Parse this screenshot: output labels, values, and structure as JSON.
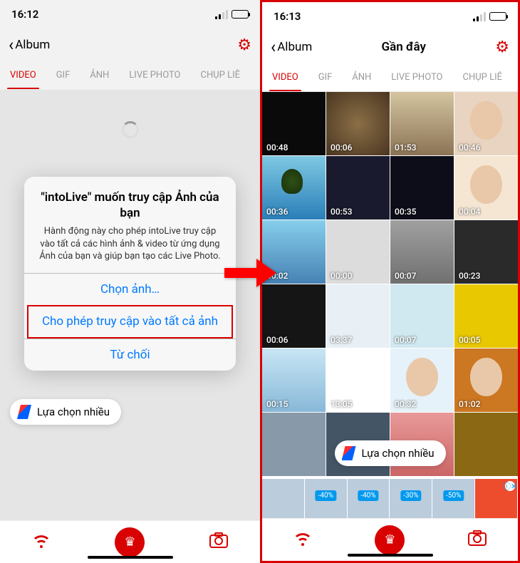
{
  "left": {
    "status_time": "16:12",
    "back_label": "Album",
    "tabs": [
      "VIDEO",
      "GIF",
      "ẢNH",
      "LIVE PHOTO",
      "CHỤP LIÊ"
    ],
    "alert": {
      "title": "\"intoLive\" muốn truy cập Ảnh của bạn",
      "message": "Hành động này cho phép intoLive truy cập vào tất cả các hình ảnh & video từ ứng dụng Ảnh của bạn và giúp bạn tạo các Live Photo.",
      "btn_select": "Chọn ảnh…",
      "btn_allow": "Cho phép truy cập vào tất cả ảnh",
      "btn_deny": "Từ chối"
    },
    "pill_label": "Lựa chọn nhiều"
  },
  "right": {
    "status_time": "16:13",
    "back_label": "Album",
    "title": "Gần đây",
    "tabs": [
      "VIDEO",
      "GIF",
      "ẢNH",
      "LIVE PHOTO",
      "CHỤP LIÊ"
    ],
    "pill_label": "Lựa chọn nhiều",
    "videos": [
      {
        "dur": "00:48"
      },
      {
        "dur": "00:06"
      },
      {
        "dur": "01:53"
      },
      {
        "dur": "00:46"
      },
      {
        "dur": "00:36"
      },
      {
        "dur": "00:53"
      },
      {
        "dur": "00:35"
      },
      {
        "dur": "00:04"
      },
      {
        "dur": "00:02"
      },
      {
        "dur": "00:00"
      },
      {
        "dur": "00:07"
      },
      {
        "dur": "00:23"
      },
      {
        "dur": "00:06"
      },
      {
        "dur": "03:37"
      },
      {
        "dur": "00:07"
      },
      {
        "dur": "00:05"
      },
      {
        "dur": "00:15"
      },
      {
        "dur": "13:05"
      },
      {
        "dur": "00:32"
      },
      {
        "dur": "01:02"
      },
      {
        "dur": ""
      },
      {
        "dur": ""
      },
      {
        "dur": ""
      },
      {
        "dur": ""
      }
    ],
    "ad_badges": [
      "-40%",
      "-40%",
      "-30%",
      "-50%"
    ]
  }
}
